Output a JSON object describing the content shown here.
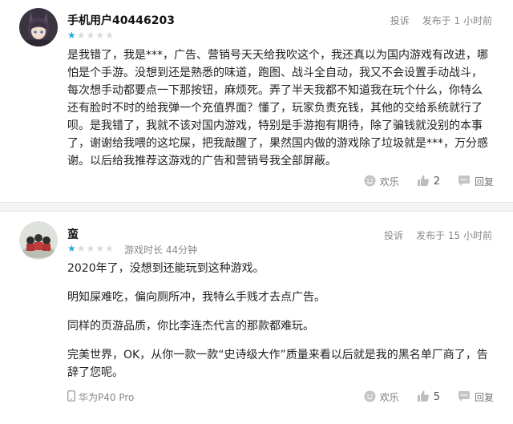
{
  "colors": {
    "accent": "#2aa9d4",
    "star_off": "#d8d8d8",
    "meta": "#888888"
  },
  "reviews": [
    {
      "username": "手机用户40446203",
      "rating": 1,
      "report": "投诉",
      "time": "发布于 1 小时前",
      "paragraphs": [
        "是我错了，我是***，广告、营销号天天给我吹这个，我还真以为国内游戏有改进，哪怕是个手游。没想到还是熟悉的味道，跑图、战斗全自动，我又不会设置手动战斗，每次想手动都要点一下那按钮，麻烦死。弄了半天我都不知道我在玩个什么，你特么还有脸时不时的给我弹一个充值界面？懂了，玩家负责充钱，其他的交给系统就行了呗。是我错了，我就不该对国内游戏，特别是手游抱有期待，除了骗钱就没别的本事了，谢谢给我喂的这坨屎，把我敲醒了，果然国内做的游戏除了垃圾就是***，万分感谢。以后给我推荐这游戏的广告和营销号我全部屏蔽。"
      ],
      "actions": {
        "happy": "欢乐",
        "likes": "2",
        "reply": "回复"
      }
    },
    {
      "username": "蛮",
      "rating": 1,
      "playtime": "游戏时长 44分钟",
      "report": "投诉",
      "time": "发布于 15 小时前",
      "paragraphs": [
        "2020年了，没想到还能玩到这种游戏。",
        "明知屎难吃，偏向厕所冲，我特么手贱才去点广告。",
        "同样的页游品质，你比李连杰代言的那款都难玩。",
        "完美世界，OK，从你一款一款“史诗级大作”质量来看以后就是我的黑名单厂商了，告辞了您呢。"
      ],
      "device": "华为P40 Pro",
      "actions": {
        "happy": "欢乐",
        "likes": "5",
        "reply": "回复"
      }
    }
  ]
}
